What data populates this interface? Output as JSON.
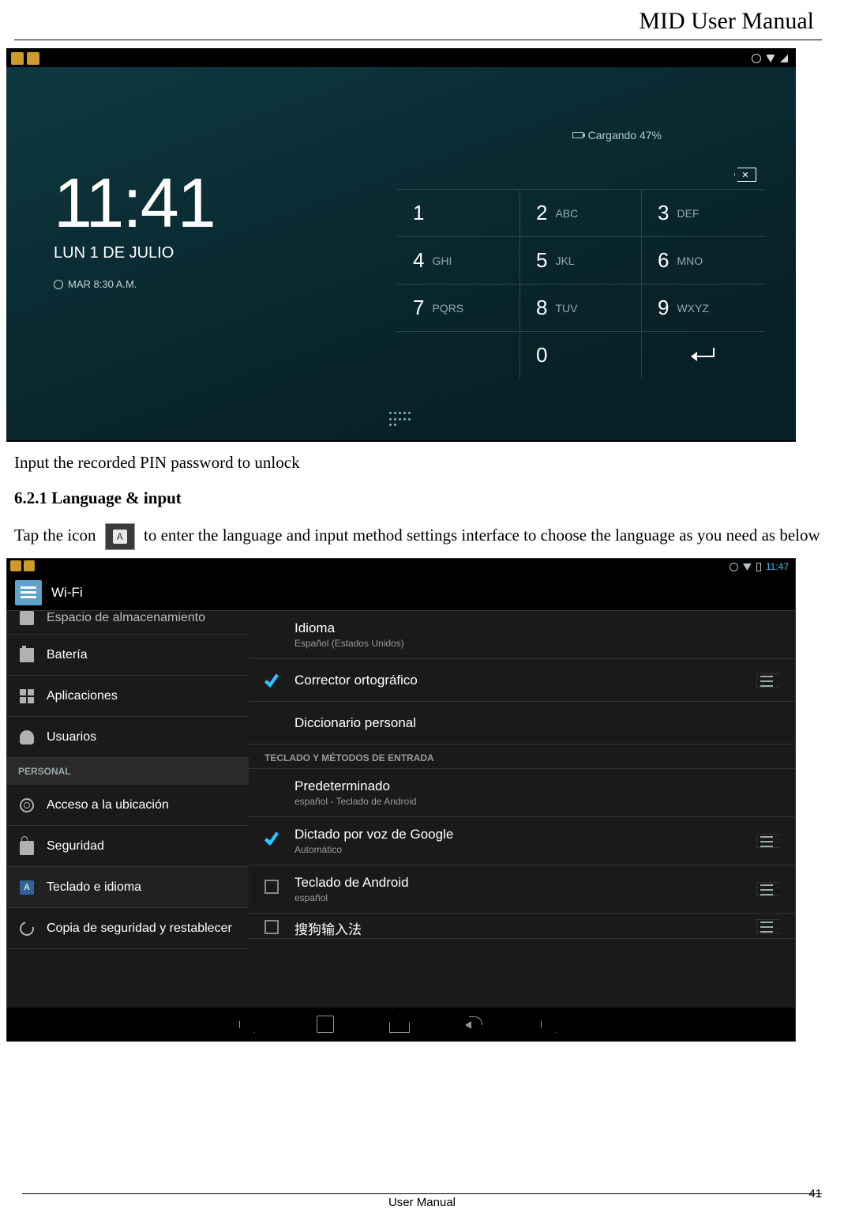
{
  "doc": {
    "title": "MID User Manual",
    "footer_label": "User Manual",
    "page_number": "41"
  },
  "text": {
    "caption1": "Input the recorded PIN password to unlock",
    "section_heading": "6.2.1 Language & input",
    "para_pre": "Tap the icon ",
    "para_post": " to enter the language and input method settings interface to choose the language as you need as below"
  },
  "ss1": {
    "charge_text": "Cargando 47%",
    "time": "11:41",
    "date": "LUN 1 DE JULIO",
    "alarm": "MAR 8:30 A.M.",
    "keys": [
      {
        "n": "1",
        "l": ""
      },
      {
        "n": "2",
        "l": "ABC"
      },
      {
        "n": "3",
        "l": "DEF"
      },
      {
        "n": "4",
        "l": "GHI"
      },
      {
        "n": "5",
        "l": "JKL"
      },
      {
        "n": "6",
        "l": "MNO"
      },
      {
        "n": "7",
        "l": "PQRS"
      },
      {
        "n": "8",
        "l": "TUV"
      },
      {
        "n": "9",
        "l": "WXYZ"
      },
      {
        "n": "",
        "l": ""
      },
      {
        "n": "0",
        "l": ""
      },
      {
        "n": "",
        "l": "",
        "enter": true
      }
    ]
  },
  "ss2": {
    "status_time": "11:47",
    "appbar_title": "Wi-Fi",
    "sidebar": {
      "half_item": "Espacio de almacenamiento",
      "items": [
        {
          "label": "Batería",
          "icon": "battery"
        },
        {
          "label": "Aplicaciones",
          "icon": "apps"
        },
        {
          "label": "Usuarios",
          "icon": "user"
        }
      ],
      "header": "PERSONAL",
      "items2": [
        {
          "label": "Acceso a la ubicación",
          "icon": "loc"
        },
        {
          "label": "Seguridad",
          "icon": "lock"
        },
        {
          "label": "Teclado e idioma",
          "icon": "lang",
          "sel": true
        },
        {
          "label": "Copia de seguridad y restablecer",
          "icon": "backup"
        }
      ]
    },
    "content": {
      "r1": {
        "t": "Idioma",
        "s": "Español (Estados Unidos)"
      },
      "r2": {
        "t": "Corrector ortográfico"
      },
      "r3": {
        "t": "Diccionario personal"
      },
      "hdr": "TECLADO Y MÉTODOS DE ENTRADA",
      "r4": {
        "t": "Predeterminado",
        "s": "español - Teclado de Android"
      },
      "r5": {
        "t": "Dictado por voz de Google",
        "s": "Automático"
      },
      "r6": {
        "t": "Teclado de Android",
        "s": "español"
      },
      "r7": {
        "t": "搜狗输入法"
      }
    }
  }
}
